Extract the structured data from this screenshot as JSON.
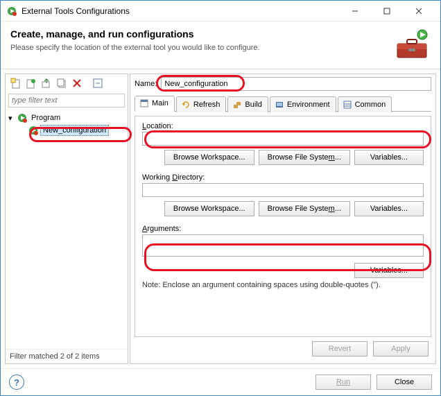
{
  "window": {
    "title": "External Tools Configurations"
  },
  "header": {
    "title": "Create, manage, and run configurations",
    "subtitle": "Please specify the location of the external tool you would like to configure."
  },
  "left": {
    "filter_placeholder": "type filter text",
    "root": "Program",
    "child": "New_configuration",
    "status": "Filter matched 2 of 2 items"
  },
  "name": {
    "label": "Name:",
    "value": "New_configuration"
  },
  "tabs": {
    "main": "Main",
    "refresh": "Refresh",
    "build": "Build",
    "environment": "Environment",
    "common": "Common"
  },
  "main_panel": {
    "location_label": "Location:",
    "working_dir_label": "Working Directory:",
    "arguments_label": "Arguments:",
    "browse_workspace": "Browse Workspace...",
    "browse_filesystem_html": "Browse File Syste<u>m</u>...",
    "variables": "Variables...",
    "note": "Note: Enclose an argument containing spaces using double-quotes (\")."
  },
  "buttons": {
    "revert": "Revert",
    "apply": "Apply",
    "run": "Run",
    "close": "Close"
  }
}
